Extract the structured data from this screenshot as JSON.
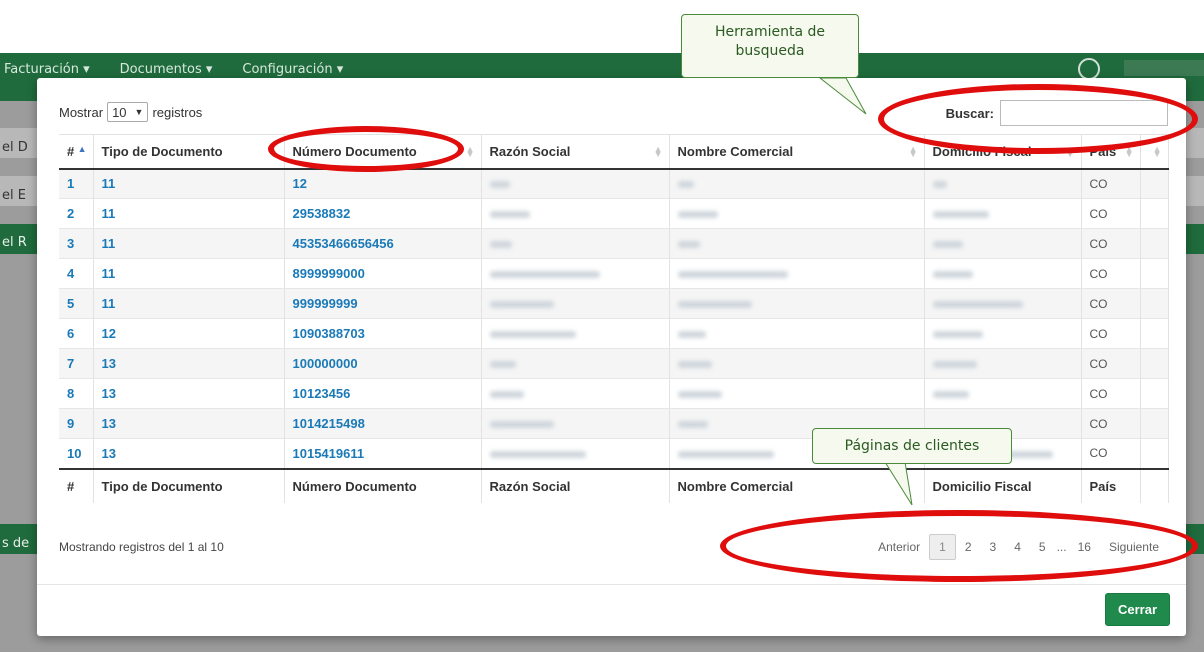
{
  "navbar": {
    "menu": [
      "Facturación ▾",
      "Documentos ▾",
      "Configuración ▾"
    ]
  },
  "background": {
    "side_labels": [
      "el D",
      "el E",
      "el R",
      "s de"
    ]
  },
  "modal": {
    "length": {
      "prefix": "Mostrar",
      "value": "10",
      "suffix": "registros"
    },
    "search": {
      "label": "Buscar:",
      "value": ""
    },
    "table": {
      "headers": [
        "#",
        "Tipo de Documento",
        "Número Documento",
        "Razón Social",
        "Nombre Comercial",
        "Domicilio Fiscal",
        "País"
      ],
      "rows": [
        {
          "n": "1",
          "tipo": "11",
          "doc": "12",
          "pais": "CO"
        },
        {
          "n": "2",
          "tipo": "11",
          "doc": "29538832",
          "pais": "CO"
        },
        {
          "n": "3",
          "tipo": "11",
          "doc": "45353466656456",
          "pais": "CO"
        },
        {
          "n": "4",
          "tipo": "11",
          "doc": "8999999000",
          "pais": "CO"
        },
        {
          "n": "5",
          "tipo": "11",
          "doc": "999999999",
          "pais": "CO"
        },
        {
          "n": "6",
          "tipo": "12",
          "doc": "1090388703",
          "pais": "CO"
        },
        {
          "n": "7",
          "tipo": "13",
          "doc": "100000000",
          "pais": "CO"
        },
        {
          "n": "8",
          "tipo": "13",
          "doc": "10123456",
          "pais": "CO"
        },
        {
          "n": "9",
          "tipo": "13",
          "doc": "1014215498",
          "pais": "CO"
        },
        {
          "n": "10",
          "tipo": "13",
          "doc": "1015419611",
          "pais": "CO"
        }
      ]
    },
    "info": "Mostrando registros del 1 al 10",
    "pagination": {
      "prev": "Anterior",
      "pages": [
        "1",
        "2",
        "3",
        "4",
        "5",
        "...",
        "16"
      ],
      "next": "Siguiente"
    },
    "close_label": "Cerrar"
  },
  "annotations": {
    "search_callout": "Herramienta de busqueda",
    "pages_callout": "Páginas de clientes",
    "highlight_color": "#e00d0d"
  }
}
